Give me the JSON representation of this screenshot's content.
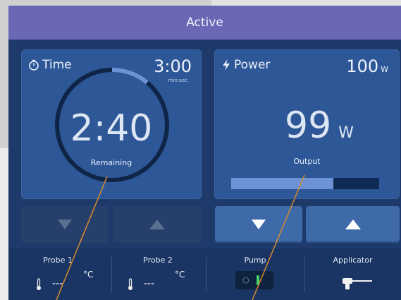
{
  "header": {
    "title": "Active"
  },
  "time_card": {
    "title": "Time",
    "set_value": "3:00",
    "set_unit": "min:sec",
    "remaining_value": "2:40",
    "remaining_label": "Remaining",
    "ring_progress_fraction": 0.11
  },
  "power_card": {
    "title": "Power",
    "set_value": "100",
    "set_unit": "W",
    "output_value": "99",
    "output_unit": "W",
    "output_label": "Output",
    "output_bar_fraction": 0.69
  },
  "footer": {
    "probe1": {
      "label": "Probe 1",
      "value": "---",
      "unit": "°C"
    },
    "probe2": {
      "label": "Probe 2",
      "value": "---",
      "unit": "°C"
    },
    "pump": {
      "label": "Pump"
    },
    "applicator": {
      "label": "Applicator"
    }
  },
  "colors": {
    "header": "#6a68b4",
    "card": "#2e5797",
    "accent": "#6d93d6",
    "pump_on": "#3fd46a",
    "pointer": "#d98a2b"
  }
}
